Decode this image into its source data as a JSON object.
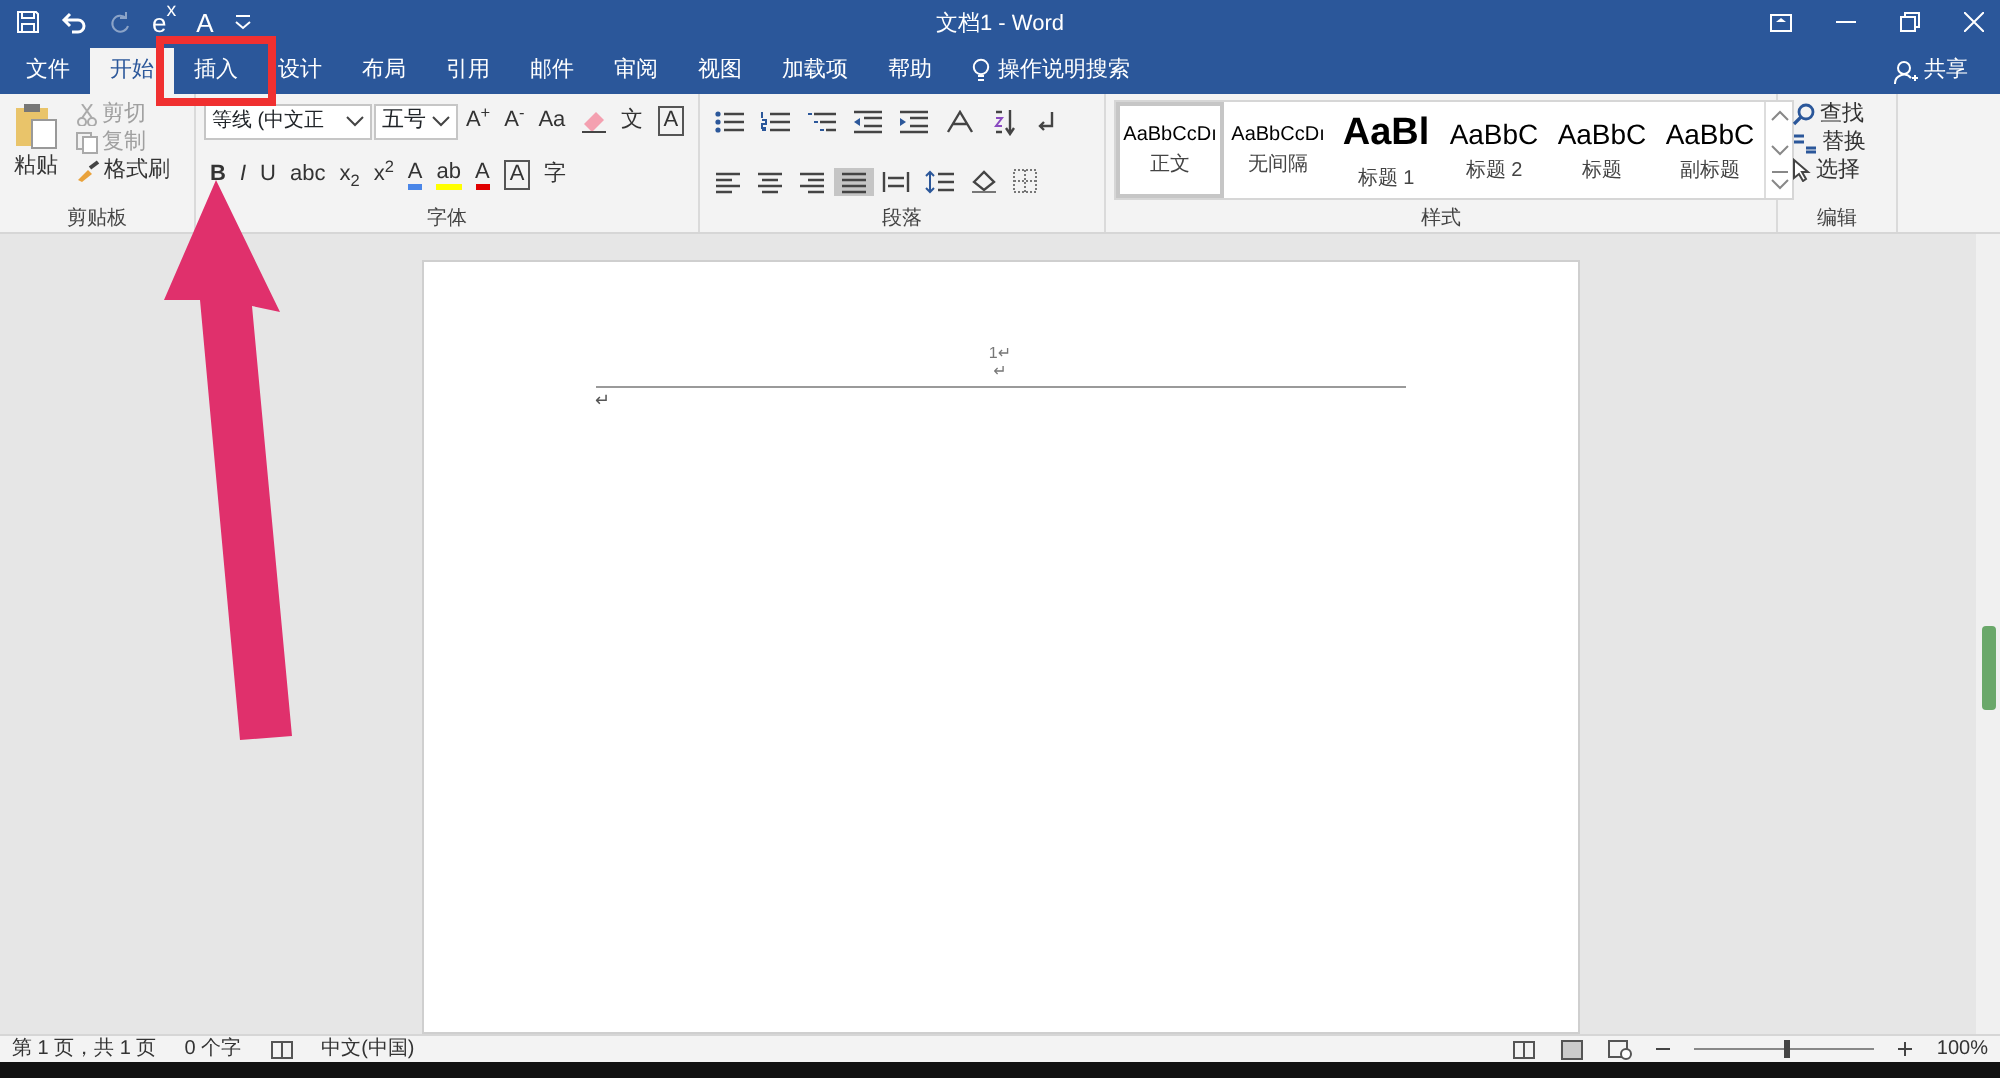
{
  "window": {
    "title": "文档1 - Word"
  },
  "quick_access": [
    {
      "kind": "save"
    },
    {
      "kind": "undo"
    },
    {
      "kind": "redo",
      "disabled": true
    },
    {
      "kind": "text",
      "label": "e$^{x}$"
    },
    {
      "kind": "text",
      "label": "A"
    },
    {
      "kind": "customize"
    }
  ],
  "tabs": [
    {
      "label": "文件",
      "selected": false
    },
    {
      "label": "开始",
      "selected": true
    },
    {
      "label": "插入",
      "selected": false,
      "annotated": true
    },
    {
      "label": "设计",
      "selected": false
    },
    {
      "label": "布局",
      "selected": false
    },
    {
      "label": "引用",
      "selected": false
    },
    {
      "label": "邮件",
      "selected": false
    },
    {
      "label": "审阅",
      "selected": false
    },
    {
      "label": "视图",
      "selected": false
    },
    {
      "label": "加载项",
      "selected": false
    },
    {
      "label": "帮助",
      "selected": false
    }
  ],
  "tell_me": {
    "placeholder": "操作说明搜索"
  },
  "share": {
    "label": "共享"
  },
  "clipboard": {
    "title": "剪贴板",
    "paste": "粘贴",
    "items": [
      {
        "label": "剪切",
        "disabled": true
      },
      {
        "label": "复制",
        "disabled": true
      },
      {
        "label": "格式刷",
        "disabled": false
      }
    ]
  },
  "font": {
    "title": "字体",
    "name": "等线 (中文正",
    "size": "五号",
    "row1": [
      {
        "kind": "text",
        "label": "A$^{+}$"
      },
      {
        "kind": "text",
        "label": "A$^{-}$"
      },
      {
        "kind": "text",
        "label": "Aa"
      },
      {
        "kind": "eraser"
      },
      {
        "kind": "text",
        "label": "文"
      },
      {
        "kind": "text",
        "label": "A",
        "boxed": true
      }
    ],
    "row2": [
      {
        "kind": "text",
        "label": "**B**"
      },
      {
        "kind": "text",
        "label": "*I*"
      },
      {
        "kind": "text",
        "label": "U"
      },
      {
        "kind": "text",
        "label": "abc"
      },
      {
        "kind": "text",
        "label": "x$_{2}$"
      },
      {
        "kind": "text",
        "label": "x$^{2}$"
      },
      {
        "kind": "text",
        "label": "A",
        "color": "#4a86e8"
      },
      {
        "kind": "text",
        "label": "ab",
        "color": "#ffff00"
      },
      {
        "kind": "text",
        "label": "A",
        "color": "#e00000"
      },
      {
        "kind": "text",
        "label": "A",
        "boxed": true
      },
      {
        "kind": "text",
        "label": "字"
      }
    ]
  },
  "paragraph": {
    "title": "段落",
    "row1": [
      {
        "kind": "bullets",
        "selected": false
      },
      {
        "kind": "numbering",
        "selected": false
      },
      {
        "kind": "multilevel",
        "selected": false
      },
      {
        "kind": "outdent",
        "selected": false
      },
      {
        "kind": "indent",
        "selected": false
      },
      {
        "kind": "layout",
        "selected": false
      },
      {
        "kind": "sort",
        "selected": false
      },
      {
        "kind": "marks",
        "selected": false
      }
    ],
    "row2": [
      {
        "kind": "left",
        "selected": false
      },
      {
        "kind": "center",
        "selected": false
      },
      {
        "kind": "right",
        "selected": false
      },
      {
        "kind": "justify",
        "selected": true
      },
      {
        "kind": "distribute",
        "selected": false
      },
      {
        "kind": "spacing",
        "selected": false
      },
      {
        "kind": "shading",
        "selected": false
      },
      {
        "kind": "borders",
        "selected": false
      }
    ]
  },
  "styles": {
    "title": "样式",
    "items": [
      {
        "preview": "AaBbCcDı",
        "name": "正文",
        "selected": true,
        "kind": "body"
      },
      {
        "preview": "AaBbCcDı",
        "name": "无间隔",
        "selected": false,
        "kind": "body"
      },
      {
        "preview": "AaBl",
        "name": "标题 1",
        "selected": false,
        "kind": "h1"
      },
      {
        "preview": "AaBbC",
        "name": "标题 2",
        "selected": false,
        "kind": "h2"
      },
      {
        "preview": "AaBbC",
        "name": "标题",
        "selected": false,
        "kind": "h2"
      },
      {
        "preview": "AaBbC",
        "name": "副标题",
        "selected": false,
        "kind": "h2"
      }
    ]
  },
  "editing": {
    "title": "编辑",
    "items": [
      {
        "label": "查找",
        "kind": "find"
      },
      {
        "label": "替换",
        "kind": "replace"
      },
      {
        "label": "选择",
        "kind": "select"
      }
    ]
  },
  "document": {
    "header": [
      "1↵",
      "↵"
    ],
    "body": "↵"
  },
  "status_bar": {
    "pages": "第 1 页，共 1 页",
    "words": "0 个字",
    "language": "中文(中国)",
    "zoom": {
      "level": 0.5,
      "reading": "100%"
    }
  }
}
